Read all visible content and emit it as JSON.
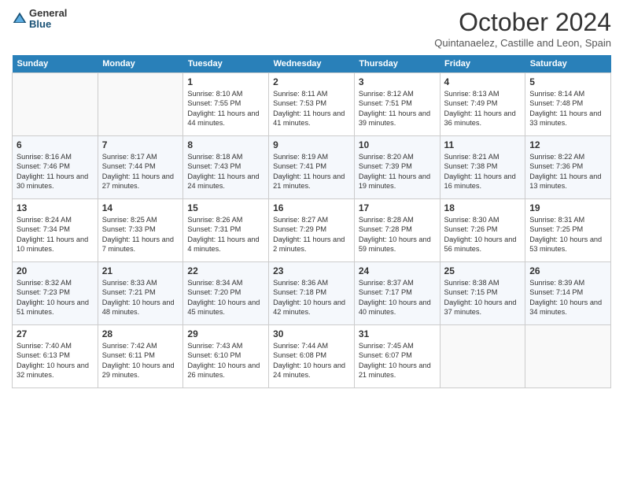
{
  "logo": {
    "general": "General",
    "blue": "Blue"
  },
  "title": "October 2024",
  "subtitle": "Quintanaelez, Castille and Leon, Spain",
  "days": [
    "Sunday",
    "Monday",
    "Tuesday",
    "Wednesday",
    "Thursday",
    "Friday",
    "Saturday"
  ],
  "weeks": [
    [
      {
        "date": "",
        "content": ""
      },
      {
        "date": "",
        "content": ""
      },
      {
        "date": "1",
        "content": "Sunrise: 8:10 AM\nSunset: 7:55 PM\nDaylight: 11 hours and 44 minutes."
      },
      {
        "date": "2",
        "content": "Sunrise: 8:11 AM\nSunset: 7:53 PM\nDaylight: 11 hours and 41 minutes."
      },
      {
        "date": "3",
        "content": "Sunrise: 8:12 AM\nSunset: 7:51 PM\nDaylight: 11 hours and 39 minutes."
      },
      {
        "date": "4",
        "content": "Sunrise: 8:13 AM\nSunset: 7:49 PM\nDaylight: 11 hours and 36 minutes."
      },
      {
        "date": "5",
        "content": "Sunrise: 8:14 AM\nSunset: 7:48 PM\nDaylight: 11 hours and 33 minutes."
      }
    ],
    [
      {
        "date": "6",
        "content": "Sunrise: 8:16 AM\nSunset: 7:46 PM\nDaylight: 11 hours and 30 minutes."
      },
      {
        "date": "7",
        "content": "Sunrise: 8:17 AM\nSunset: 7:44 PM\nDaylight: 11 hours and 27 minutes."
      },
      {
        "date": "8",
        "content": "Sunrise: 8:18 AM\nSunset: 7:43 PM\nDaylight: 11 hours and 24 minutes."
      },
      {
        "date": "9",
        "content": "Sunrise: 8:19 AM\nSunset: 7:41 PM\nDaylight: 11 hours and 21 minutes."
      },
      {
        "date": "10",
        "content": "Sunrise: 8:20 AM\nSunset: 7:39 PM\nDaylight: 11 hours and 19 minutes."
      },
      {
        "date": "11",
        "content": "Sunrise: 8:21 AM\nSunset: 7:38 PM\nDaylight: 11 hours and 16 minutes."
      },
      {
        "date": "12",
        "content": "Sunrise: 8:22 AM\nSunset: 7:36 PM\nDaylight: 11 hours and 13 minutes."
      }
    ],
    [
      {
        "date": "13",
        "content": "Sunrise: 8:24 AM\nSunset: 7:34 PM\nDaylight: 11 hours and 10 minutes."
      },
      {
        "date": "14",
        "content": "Sunrise: 8:25 AM\nSunset: 7:33 PM\nDaylight: 11 hours and 7 minutes."
      },
      {
        "date": "15",
        "content": "Sunrise: 8:26 AM\nSunset: 7:31 PM\nDaylight: 11 hours and 4 minutes."
      },
      {
        "date": "16",
        "content": "Sunrise: 8:27 AM\nSunset: 7:29 PM\nDaylight: 11 hours and 2 minutes."
      },
      {
        "date": "17",
        "content": "Sunrise: 8:28 AM\nSunset: 7:28 PM\nDaylight: 10 hours and 59 minutes."
      },
      {
        "date": "18",
        "content": "Sunrise: 8:30 AM\nSunset: 7:26 PM\nDaylight: 10 hours and 56 minutes."
      },
      {
        "date": "19",
        "content": "Sunrise: 8:31 AM\nSunset: 7:25 PM\nDaylight: 10 hours and 53 minutes."
      }
    ],
    [
      {
        "date": "20",
        "content": "Sunrise: 8:32 AM\nSunset: 7:23 PM\nDaylight: 10 hours and 51 minutes."
      },
      {
        "date": "21",
        "content": "Sunrise: 8:33 AM\nSunset: 7:21 PM\nDaylight: 10 hours and 48 minutes."
      },
      {
        "date": "22",
        "content": "Sunrise: 8:34 AM\nSunset: 7:20 PM\nDaylight: 10 hours and 45 minutes."
      },
      {
        "date": "23",
        "content": "Sunrise: 8:36 AM\nSunset: 7:18 PM\nDaylight: 10 hours and 42 minutes."
      },
      {
        "date": "24",
        "content": "Sunrise: 8:37 AM\nSunset: 7:17 PM\nDaylight: 10 hours and 40 minutes."
      },
      {
        "date": "25",
        "content": "Sunrise: 8:38 AM\nSunset: 7:15 PM\nDaylight: 10 hours and 37 minutes."
      },
      {
        "date": "26",
        "content": "Sunrise: 8:39 AM\nSunset: 7:14 PM\nDaylight: 10 hours and 34 minutes."
      }
    ],
    [
      {
        "date": "27",
        "content": "Sunrise: 7:40 AM\nSunset: 6:13 PM\nDaylight: 10 hours and 32 minutes."
      },
      {
        "date": "28",
        "content": "Sunrise: 7:42 AM\nSunset: 6:11 PM\nDaylight: 10 hours and 29 minutes."
      },
      {
        "date": "29",
        "content": "Sunrise: 7:43 AM\nSunset: 6:10 PM\nDaylight: 10 hours and 26 minutes."
      },
      {
        "date": "30",
        "content": "Sunrise: 7:44 AM\nSunset: 6:08 PM\nDaylight: 10 hours and 24 minutes."
      },
      {
        "date": "31",
        "content": "Sunrise: 7:45 AM\nSunset: 6:07 PM\nDaylight: 10 hours and 21 minutes."
      },
      {
        "date": "",
        "content": ""
      },
      {
        "date": "",
        "content": ""
      }
    ]
  ]
}
